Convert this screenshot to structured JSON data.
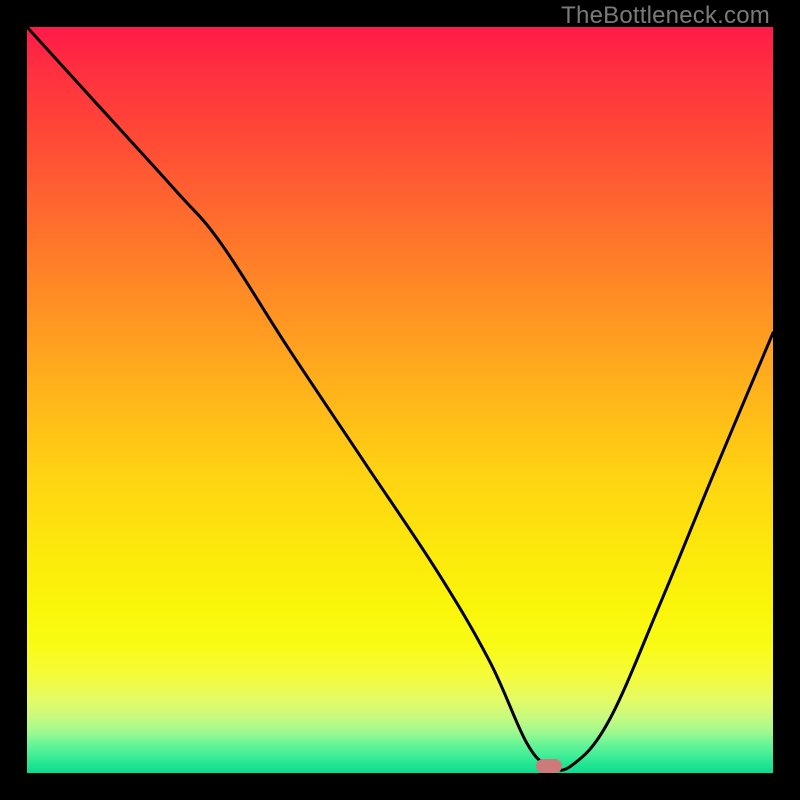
{
  "watermark": "TheBottleneck.com",
  "colors": {
    "background": "#000000",
    "curve_stroke": "#000000",
    "marker_fill": "#cc7a7a"
  },
  "chart_data": {
    "type": "line",
    "title": "",
    "xlabel": "",
    "ylabel": "",
    "xlim": [
      0,
      100
    ],
    "ylim": [
      0,
      100
    ],
    "annotations": [
      {
        "type": "marker",
        "x": 70,
        "y": 1,
        "label": "optimal-point"
      }
    ],
    "series": [
      {
        "name": "bottleneck-curve",
        "x": [
          0,
          10,
          20,
          26,
          35,
          45,
          55,
          62,
          67,
          70,
          73,
          78,
          85,
          92,
          100
        ],
        "y": [
          100,
          89,
          78,
          71,
          57,
          42,
          27,
          15,
          4,
          1,
          1,
          7,
          23,
          40,
          59
        ]
      }
    ],
    "background_gradient": {
      "type": "vertical",
      "stops": [
        {
          "pos": 0.0,
          "color": "#ff1a49"
        },
        {
          "pos": 0.25,
          "color": "#ff6a2e"
        },
        {
          "pos": 0.5,
          "color": "#ffb81b"
        },
        {
          "pos": 0.75,
          "color": "#faf60a"
        },
        {
          "pos": 0.93,
          "color": "#c7fa7f"
        },
        {
          "pos": 1.0,
          "color": "#0fdb8d"
        }
      ]
    }
  }
}
